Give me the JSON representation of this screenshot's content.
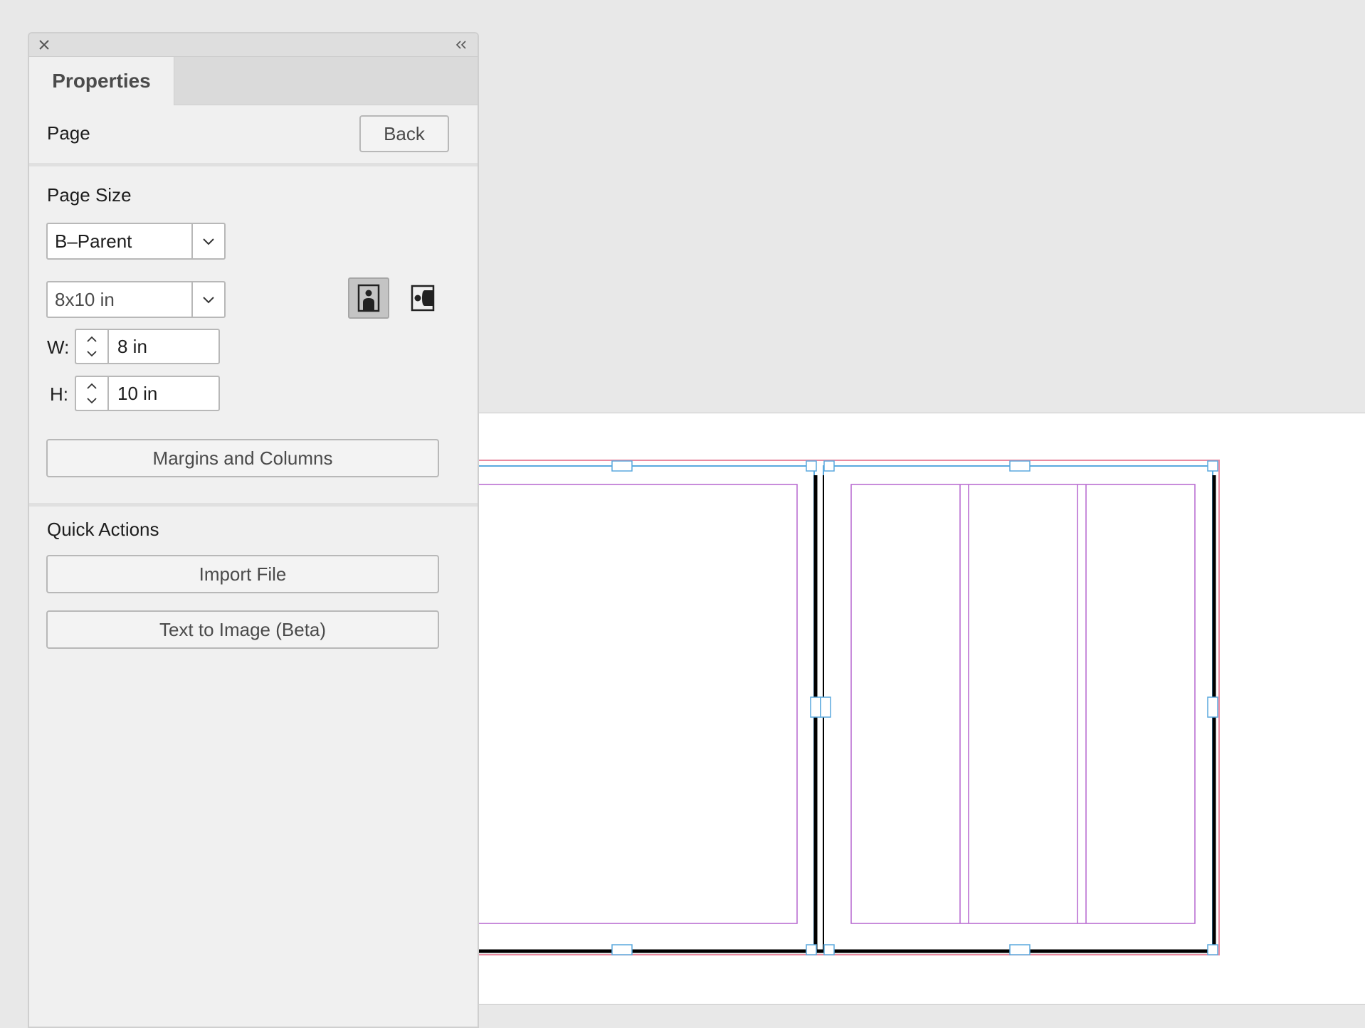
{
  "panel": {
    "tab_label": "Properties",
    "page_section": {
      "title": "Page",
      "back_label": "Back"
    },
    "page_size": {
      "title": "Page Size",
      "parent_value": "B–Parent",
      "preset_value": "8x10 in",
      "orientation": "portrait",
      "width_label": "W:",
      "width_value": "8 in",
      "height_label": "H:",
      "height_value": "10 in",
      "margins_button_label": "Margins and Columns"
    },
    "quick_actions": {
      "title": "Quick Actions",
      "import_label": "Import File",
      "text_to_image_label": "Text to Image (Beta)"
    }
  },
  "icons": {
    "close": "close-icon",
    "collapse": "double-chevron-left-icon",
    "dropdown": "chevron-down-icon",
    "portrait": "portrait-orientation-icon",
    "landscape": "landscape-orientation-icon",
    "stepper_up": "chevron-up-icon",
    "stepper_down": "chevron-down-icon"
  },
  "colors": {
    "margin_guide": "#b566cf",
    "bleed_guide": "#e98aa0",
    "frame_edge": "#5aa9de",
    "page_edge": "#000000",
    "panel_bg": "#f0f0f0",
    "pasteboard": "#e8e8e8"
  }
}
